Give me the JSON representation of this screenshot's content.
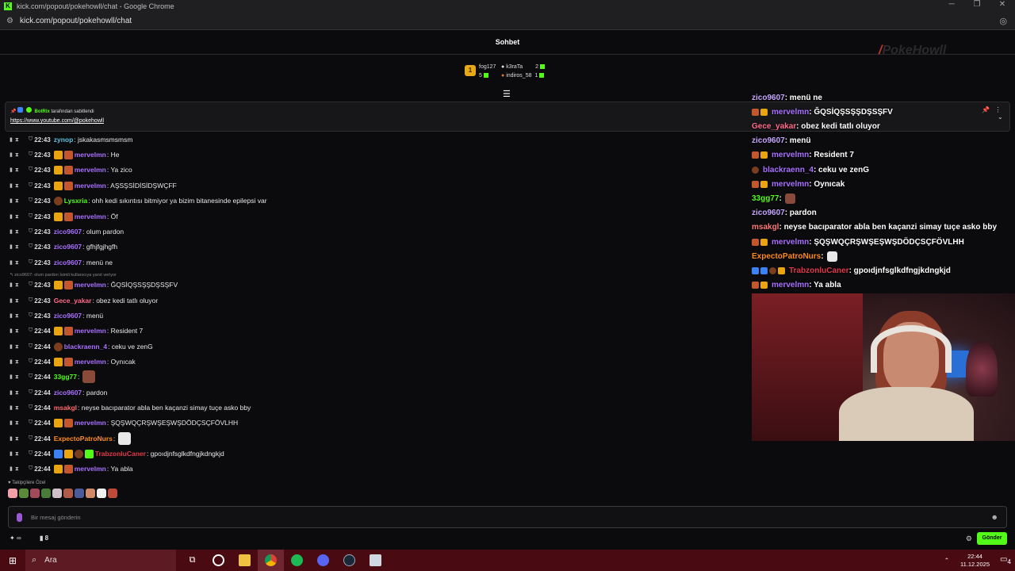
{
  "window": {
    "title": "kick.com/popout/pokehowll/chat - Google Chrome",
    "url": "kick.com/popout/pokehowll/chat"
  },
  "chat": {
    "header": "Sohbet",
    "leaders": [
      {
        "name": "fog127",
        "amount": "5"
      },
      {
        "name": "k3raTa",
        "amount": "2"
      },
      {
        "name": "indiros_58",
        "amount": "1"
      }
    ],
    "pinned": {
      "by": "BotRix tarafından sabitlendi",
      "by_user": "BotRix",
      "by_suffix": " tarafından sabitlendi",
      "link": "https://www.youtube.com/@pokehowll"
    },
    "reply_hint": "zico9607: olum pardon İsimli kullanıcıya yanıt veriyor",
    "followers_label": "Takipçilere Özel",
    "input_placeholder": "Bir mesaj gönderin",
    "points": "∞",
    "viewer_count": "8",
    "send_label": "Gönder",
    "colors": {
      "accent": "#53fc18",
      "purple": "#a970ff",
      "blue": "#3b82f6",
      "green": "#53fc18",
      "orange": "#ff8c1a",
      "pink": "#ff6b6b",
      "red": "#e0394b",
      "salmon": "#ff7a7a"
    },
    "messages": [
      {
        "time": "22:43",
        "user": "zynop",
        "color": "#5bc0de",
        "text": ": jskakasmsmsmsm",
        "badges": []
      },
      {
        "time": "22:43",
        "user": "mervelmn",
        "color": "#a970ff",
        "text": ": He",
        "badges": [
          "crown",
          "sub"
        ]
      },
      {
        "time": "22:43",
        "user": "mervelmn",
        "color": "#a970ff",
        "text": ": Ya zico",
        "badges": [
          "crown",
          "sub"
        ]
      },
      {
        "time": "22:43",
        "user": "mervelmn",
        "color": "#a970ff",
        "text": ": AŞSŞSİDİSİDŞWÇFF",
        "badges": [
          "crown",
          "sub"
        ]
      },
      {
        "time": "22:43",
        "user": "Lysxria",
        "color": "#53fc18",
        "text": ": ohh kedi sıkıntısı bitmiyor ya bizim bitanesinde epilepsi var",
        "badges": [
          "bear"
        ]
      },
      {
        "time": "22:43",
        "user": "mervelmn",
        "color": "#a970ff",
        "text": ": Öf",
        "badges": [
          "crown",
          "sub"
        ]
      },
      {
        "time": "22:43",
        "user": "zico9607",
        "color": "#a970ff",
        "text": ": olum pardon",
        "badges": []
      },
      {
        "time": "22:43",
        "user": "zico9607",
        "color": "#a970ff",
        "text": ": gfhjfgjhgfh",
        "badges": []
      },
      {
        "time": "22:43",
        "user": "zico9607",
        "color": "#a970ff",
        "text": ": menü ne",
        "badges": []
      },
      {
        "time": "22:43",
        "user": "mervelmn",
        "color": "#a970ff",
        "text": ": ĞQSİQŞSŞŞDŞSŞFV",
        "badges": [
          "crown",
          "sub"
        ]
      },
      {
        "time": "22:43",
        "user": "Gece_yakar",
        "color": "#ff6b8a",
        "text": ": obez kedi tatlı oluyor",
        "badges": []
      },
      {
        "time": "22:43",
        "user": "zico9607",
        "color": "#a970ff",
        "text": ": menü",
        "badges": []
      },
      {
        "time": "22:44",
        "user": "mervelmn",
        "color": "#a970ff",
        "text": ": Resident 7",
        "badges": [
          "crown",
          "sub"
        ]
      },
      {
        "time": "22:44",
        "user": "blackraenn_4",
        "color": "#a970ff",
        "text": ": ceku ve zenG",
        "badges": [
          "bear"
        ]
      },
      {
        "time": "22:44",
        "user": "mervelmn",
        "color": "#a970ff",
        "text": ": Oynıcak",
        "badges": [
          "crown",
          "sub"
        ]
      },
      {
        "time": "22:44",
        "user": "33gg77",
        "color": "#53fc18",
        "text": ":",
        "badges": [],
        "emote": "#8a4a3a"
      },
      {
        "time": "22:44",
        "user": "zico9607",
        "color": "#a970ff",
        "text": ": pardon",
        "badges": []
      },
      {
        "time": "22:44",
        "user": "msakgl",
        "color": "#ff6b6b",
        "text": ": neyse bacıparator abla ben kaçanzi simay tuçe asko bby",
        "badges": []
      },
      {
        "time": "22:44",
        "user": "mervelmn",
        "color": "#a970ff",
        "text": ": ŞQŞWQÇRŞWŞEŞWŞDÖDÇSÇFÖVLHH",
        "badges": [
          "crown",
          "sub"
        ]
      },
      {
        "time": "22:44",
        "user": "ExpectoPatroNurs",
        "color": "#ff8c1a",
        "text": ":",
        "badges": [],
        "emote": "#e8e8e8"
      },
      {
        "time": "22:44",
        "user": "TrabzonluCaner",
        "color": "#e0394b",
        "text": ": gpoıdjnfsglkdfngjkdngkjd",
        "badges": [
          "blue",
          "crown",
          "bear",
          "green"
        ]
      },
      {
        "time": "22:44",
        "user": "mervelmn",
        "color": "#a970ff",
        "text": ": Ya abla",
        "badges": [
          "crown",
          "sub"
        ]
      }
    ]
  },
  "overlay": {
    "messages": [
      {
        "user": "zico9607",
        "color": "#c7a6ff",
        "text": ": menü ne",
        "badges": []
      },
      {
        "user": "mervelmn",
        "color": "#a970ff",
        "text": ": ĞQSİQŞSŞŞDŞSŞFV",
        "badges": [
          "sub",
          "crown"
        ]
      },
      {
        "user": "Gece_yakar",
        "color": "#ff6b8a",
        "text": ": obez kedi tatlı oluyor",
        "badges": []
      },
      {
        "user": "zico9607",
        "color": "#c7a6ff",
        "text": ": menü",
        "badges": []
      },
      {
        "user": "mervelmn",
        "color": "#a970ff",
        "text": ": Resident 7",
        "badges": [
          "sub",
          "crown"
        ]
      },
      {
        "user": "blackraenn_4",
        "color": "#a970ff",
        "text": ": ceku ve zenG",
        "badges": [
          "bear"
        ]
      },
      {
        "user": "mervelmn",
        "color": "#a970ff",
        "text": ": Oynıcak",
        "badges": [
          "sub",
          "crown"
        ]
      },
      {
        "user": "33gg77",
        "color": "#53fc18",
        "text": " :",
        "badges": [],
        "emote": "#8a4a3a"
      },
      {
        "user": "zico9607",
        "color": "#c7a6ff",
        "text": ": pardon",
        "badges": []
      },
      {
        "user": "msakgl",
        "color": "#ff7a7a",
        "text": ": neyse bacıparator abla ben kaçanzi simay tuçe asko bby",
        "badges": []
      },
      {
        "user": "mervelmn",
        "color": "#a970ff",
        "text": ": ŞQŞWQÇRŞWŞEŞWŞDÖDÇSÇFÖVLHH",
        "badges": [
          "sub",
          "crown"
        ]
      },
      {
        "user": "ExpectoPatroNurs",
        "color": "#ff8c1a",
        "text": " :",
        "badges": [],
        "emote": "#e8e8e8"
      },
      {
        "user": "TrabzonluCaner",
        "color": "#e0394b",
        "text": ": gpoıdjnfsglkdfngjkdngkjd",
        "badges": [
          "blue",
          "blue",
          "bear",
          "crown"
        ]
      },
      {
        "user": "mervelmn",
        "color": "#a970ff",
        "text": ": Ya abla",
        "badges": [
          "sub",
          "crown"
        ]
      }
    ]
  },
  "taskbar": {
    "search_placeholder": "Ara",
    "time": "22:44",
    "date": "11.12.2025",
    "notification_count": "4",
    "apps": [
      "task-view",
      "steelseries",
      "file-explorer",
      "chrome",
      "spotify",
      "discord",
      "steam",
      "storage"
    ]
  }
}
